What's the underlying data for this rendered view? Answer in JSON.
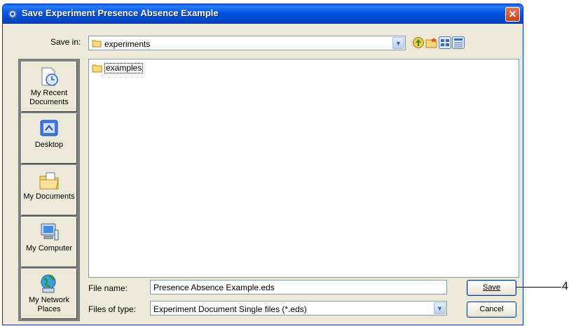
{
  "window": {
    "title": "Save Experiment Presence Absence Example",
    "close_glyph": "✕"
  },
  "save_in": {
    "label": "Save in:",
    "value": "experiments",
    "folder_icon": "folder-icon",
    "dropdown_glyph": "▼"
  },
  "toolbar": {
    "buttons": [
      {
        "name": "up-one-level-icon"
      },
      {
        "name": "create-new-folder-icon"
      },
      {
        "name": "list-view-icon"
      },
      {
        "name": "details-view-icon"
      }
    ]
  },
  "places": [
    {
      "label_lines": [
        "My Recent",
        "Documents"
      ],
      "icon": "recent-documents-icon"
    },
    {
      "label_lines": [
        "Desktop"
      ],
      "icon": "desktop-icon"
    },
    {
      "label_lines": [
        "My Documents"
      ],
      "icon": "my-documents-icon"
    },
    {
      "label_lines": [
        "My Computer"
      ],
      "icon": "my-computer-icon"
    },
    {
      "label_lines": [
        "My Network",
        "Places"
      ],
      "icon": "network-places-icon"
    }
  ],
  "files": [
    {
      "name": "examples",
      "type": "folder"
    }
  ],
  "file_name": {
    "label": "File name:",
    "value": "Presence Absence Example.eds"
  },
  "file_type": {
    "label": "Files of type:",
    "value": "Experiment Document Single files (*.eds)",
    "dropdown_glyph": "▼"
  },
  "buttons": {
    "save": "Save",
    "cancel": "Cancel"
  },
  "callout": {
    "number": "4"
  },
  "colors": {
    "titlebar": "#0054e3",
    "dialog_bg": "#ece9d8",
    "places_bg": "#808080",
    "field_border": "#7f9db9"
  }
}
